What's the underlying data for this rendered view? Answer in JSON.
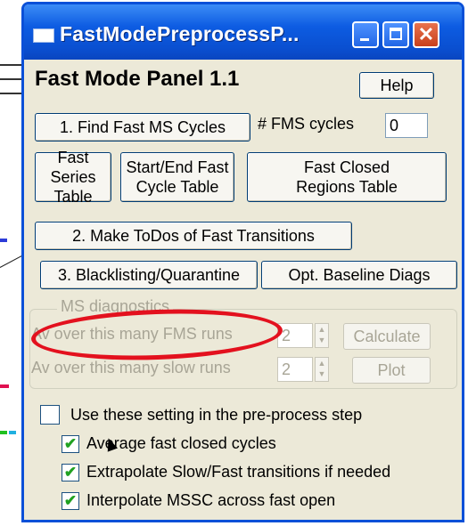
{
  "window": {
    "title": "FastModePreprocessP...",
    "colors": {
      "titlebar": "#0a4fd0",
      "body": "#ece9d8",
      "annotation": "#e3111e",
      "check": "#21a121"
    }
  },
  "panel": {
    "title": "Fast Mode Panel 1.1",
    "help_label": "Help",
    "find_cycles_label": "1. Find Fast MS Cycles",
    "fms_cycles_label": "# FMS cycles",
    "fms_cycles_value": "0",
    "fast_series_line1": "Fast Series",
    "fast_series_line2": "Table",
    "start_end_line1": "Start/End Fast",
    "start_end_line2": "Cycle Table",
    "closed_regions_line1": "Fast Closed",
    "closed_regions_line2": "Regions Table",
    "make_todos_label": "2. Make ToDos of Fast Transitions",
    "blacklisting_label": "3. Blacklisting/Quarantine",
    "baseline_diags_label": "Opt. Baseline Diags"
  },
  "ms_diagnostics": {
    "group_label": "MS diagnostics",
    "fms_runs_label": "Av over this many FMS runs",
    "fms_runs_value": "2",
    "slow_runs_label": "Av over this many slow runs",
    "slow_runs_value": "2",
    "calculate_label": "Calculate",
    "plot_label": "Plot"
  },
  "preprocess": {
    "use_settings_label": "Use these setting in the pre-process step",
    "use_settings_checked": false,
    "options": [
      {
        "label": "Average fast closed cycles",
        "checked": true
      },
      {
        "label": "Extrapolate Slow/Fast transitions if needed",
        "checked": true
      },
      {
        "label": "Interpolate MSSC across fast open",
        "checked": true
      }
    ]
  },
  "icons": [
    "window-icon",
    "minimize-icon",
    "maximize-icon",
    "close-icon",
    "spin-up-icon",
    "spin-down-icon",
    "checkmark-icon",
    "mouse-cursor-icon"
  ]
}
